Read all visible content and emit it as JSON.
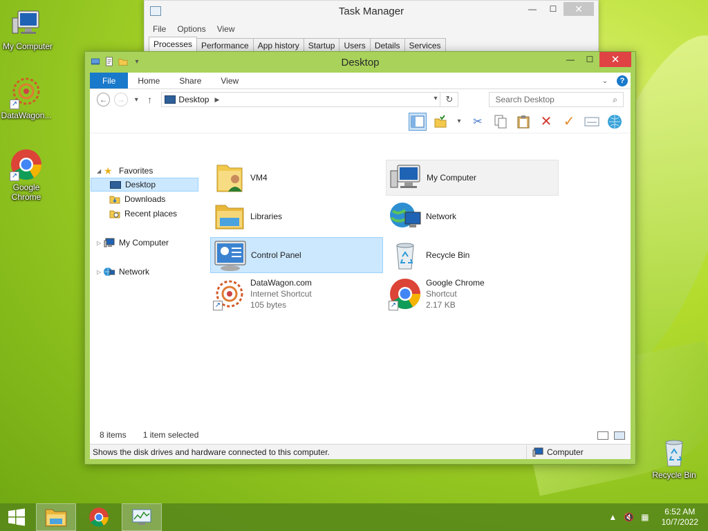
{
  "desktop": {
    "icons": [
      {
        "label": "My Computer"
      },
      {
        "label": "DataWagon..."
      },
      {
        "label": "Google Chrome"
      },
      {
        "label": "Recycle Bin"
      }
    ]
  },
  "task_manager": {
    "title": "Task Manager",
    "menu": [
      "File",
      "Options",
      "View"
    ],
    "tabs": [
      "Processes",
      "Performance",
      "App history",
      "Startup",
      "Users",
      "Details",
      "Services"
    ]
  },
  "explorer": {
    "title": "Desktop",
    "ribbon_tabs": [
      "File",
      "Home",
      "Share",
      "View"
    ],
    "address": "Desktop",
    "search_placeholder": "Search Desktop",
    "nav": {
      "favorites": "Favorites",
      "desktop": "Desktop",
      "downloads": "Downloads",
      "recent": "Recent places",
      "my_computer": "My Computer",
      "network": "Network"
    },
    "items": [
      {
        "name": "VM4"
      },
      {
        "name": "My Computer"
      },
      {
        "name": "Libraries"
      },
      {
        "name": "Network"
      },
      {
        "name": "Control Panel"
      },
      {
        "name": "Recycle Bin"
      },
      {
        "name": "DataWagon.com",
        "type": "Internet Shortcut",
        "size": "105 bytes"
      },
      {
        "name": "Google Chrome",
        "type": "Shortcut",
        "size": "2.17 KB"
      }
    ],
    "status": {
      "count": "8 items",
      "selection": "1 item selected",
      "tip": "Shows the disk drives and hardware connected to this computer.",
      "zone": "Computer"
    }
  },
  "taskbar": {
    "time": "6:52 AM",
    "date": "10/7/2022"
  },
  "colors": {
    "accent": "#1979ca",
    "close_red": "#e04343",
    "selection": "#cce8ff"
  }
}
